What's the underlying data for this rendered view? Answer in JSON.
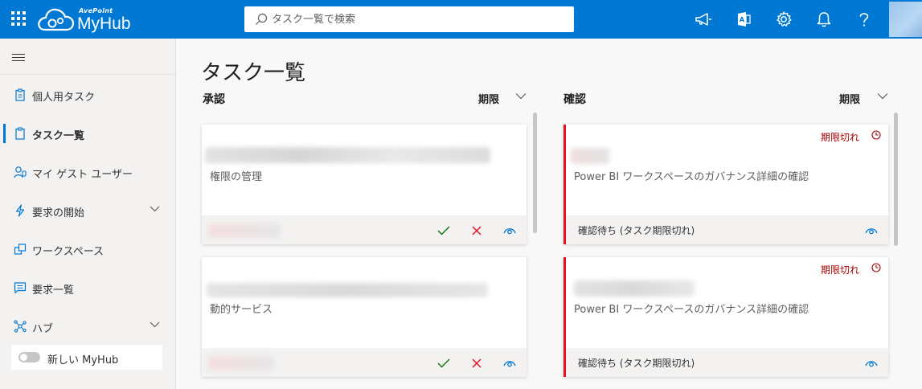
{
  "header": {
    "brand_small": "AvePoint",
    "brand": "MyHub",
    "search_placeholder": "タスク一覧で検索",
    "icons": [
      "app-launcher-icon",
      "megaphone-icon",
      "office-icon",
      "gear-icon",
      "bell-icon",
      "help-icon"
    ],
    "accent": "#0078d4"
  },
  "sidebar": {
    "items": [
      {
        "label": "個人用タスク",
        "icon": "clipboard-icon"
      },
      {
        "label": "タスク一覧",
        "icon": "clipboard-list-icon",
        "active": true
      },
      {
        "label": "マイ ゲスト ユーザー",
        "icon": "guest-user-icon"
      },
      {
        "label": "要求の開始",
        "icon": "lightning-icon",
        "expandable": true
      },
      {
        "label": "ワークスペース",
        "icon": "workspace-icon"
      },
      {
        "label": "要求一覧",
        "icon": "chat-list-icon"
      },
      {
        "label": "ハブ",
        "icon": "hub-icon",
        "expandable": true
      }
    ],
    "toggle_label": "新しい MyHub",
    "toggle_on": false
  },
  "main": {
    "title": "タスク一覧",
    "columns": [
      {
        "title": "承認",
        "sort_label": "期限",
        "cards": [
          {
            "title": "権限の管理",
            "actions": [
              "approve-icon",
              "reject-icon",
              "view-icon"
            ]
          },
          {
            "title": "動的サービス",
            "actions": [
              "approve-icon",
              "reject-icon",
              "view-icon"
            ]
          }
        ]
      },
      {
        "title": "確認",
        "sort_label": "期限",
        "cards": [
          {
            "overdue": "期限切れ",
            "title": "Power BI ワークスペースのガバナンス詳細の確認",
            "status": "確認待ち (タスク期限切れ)"
          },
          {
            "overdue": "期限切れ",
            "title": "Power BI ワークスペースのガバナンス詳細の確認",
            "status": "確認待ち (タスク期限切れ)"
          }
        ]
      }
    ]
  },
  "colors": {
    "overdue": "#a80000",
    "overdue_bar": "#e81123",
    "approve": "#107c10",
    "reject": "#e81123",
    "view": "#0078d4"
  }
}
